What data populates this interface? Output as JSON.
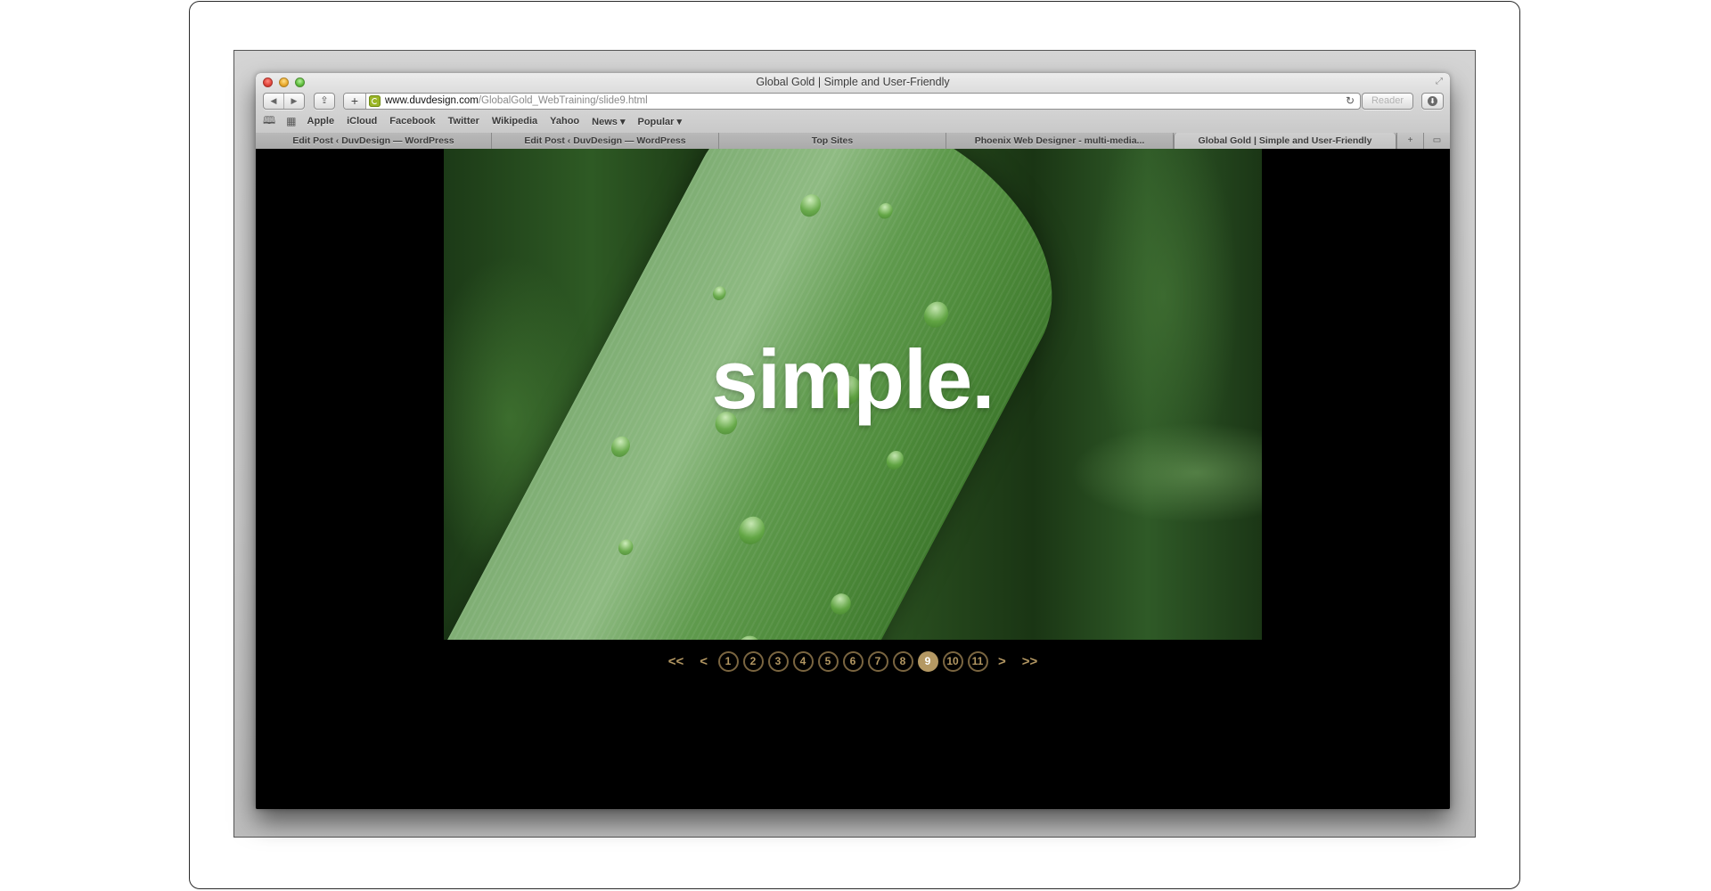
{
  "window": {
    "title": "Global Gold | Simple and User-Friendly"
  },
  "toolbar": {
    "back_icon": "◀",
    "forward_icon": "▶",
    "share_icon": "⇪",
    "add_icon": "+",
    "url_host": "www.duvdesign.com",
    "url_path": "/GlobalGold_WebTraining/slide9.html",
    "reload_icon": "↻",
    "reader_label": "Reader",
    "download_icon": "⬇",
    "fullscreen_icon": "⤢"
  },
  "bookmarks": {
    "reading_list_icon": "📖",
    "top_sites_icon": "▦",
    "items": [
      {
        "label": "Apple"
      },
      {
        "label": "iCloud"
      },
      {
        "label": "Facebook"
      },
      {
        "label": "Twitter"
      },
      {
        "label": "Wikipedia"
      },
      {
        "label": "Yahoo"
      },
      {
        "label": "News ▾"
      },
      {
        "label": "Popular ▾"
      }
    ]
  },
  "tabs": [
    {
      "label": "Edit Post ‹ DuvDesign — WordPress",
      "active": false
    },
    {
      "label": "Edit Post ‹ DuvDesign — WordPress",
      "active": false
    },
    {
      "label": "Top Sites",
      "active": false
    },
    {
      "label": "Phoenix Web Designer - multi-media...",
      "active": false
    },
    {
      "label": "Global Gold | Simple and User-Friendly",
      "active": true
    }
  ],
  "tab_controls": {
    "new_tab_icon": "+",
    "tab_view_icon": "▭"
  },
  "slide": {
    "caption": "simple.",
    "image": "green leaf with water droplets"
  },
  "pager": {
    "first_label": "<<",
    "prev_label": "<",
    "next_label": ">",
    "last_label": ">>",
    "current_page": 9,
    "pages": [
      "1",
      "2",
      "3",
      "4",
      "5",
      "6",
      "7",
      "8",
      "9",
      "10",
      "11"
    ]
  },
  "colors": {
    "accent_gold": "#b49863",
    "page_background": "#000000"
  }
}
